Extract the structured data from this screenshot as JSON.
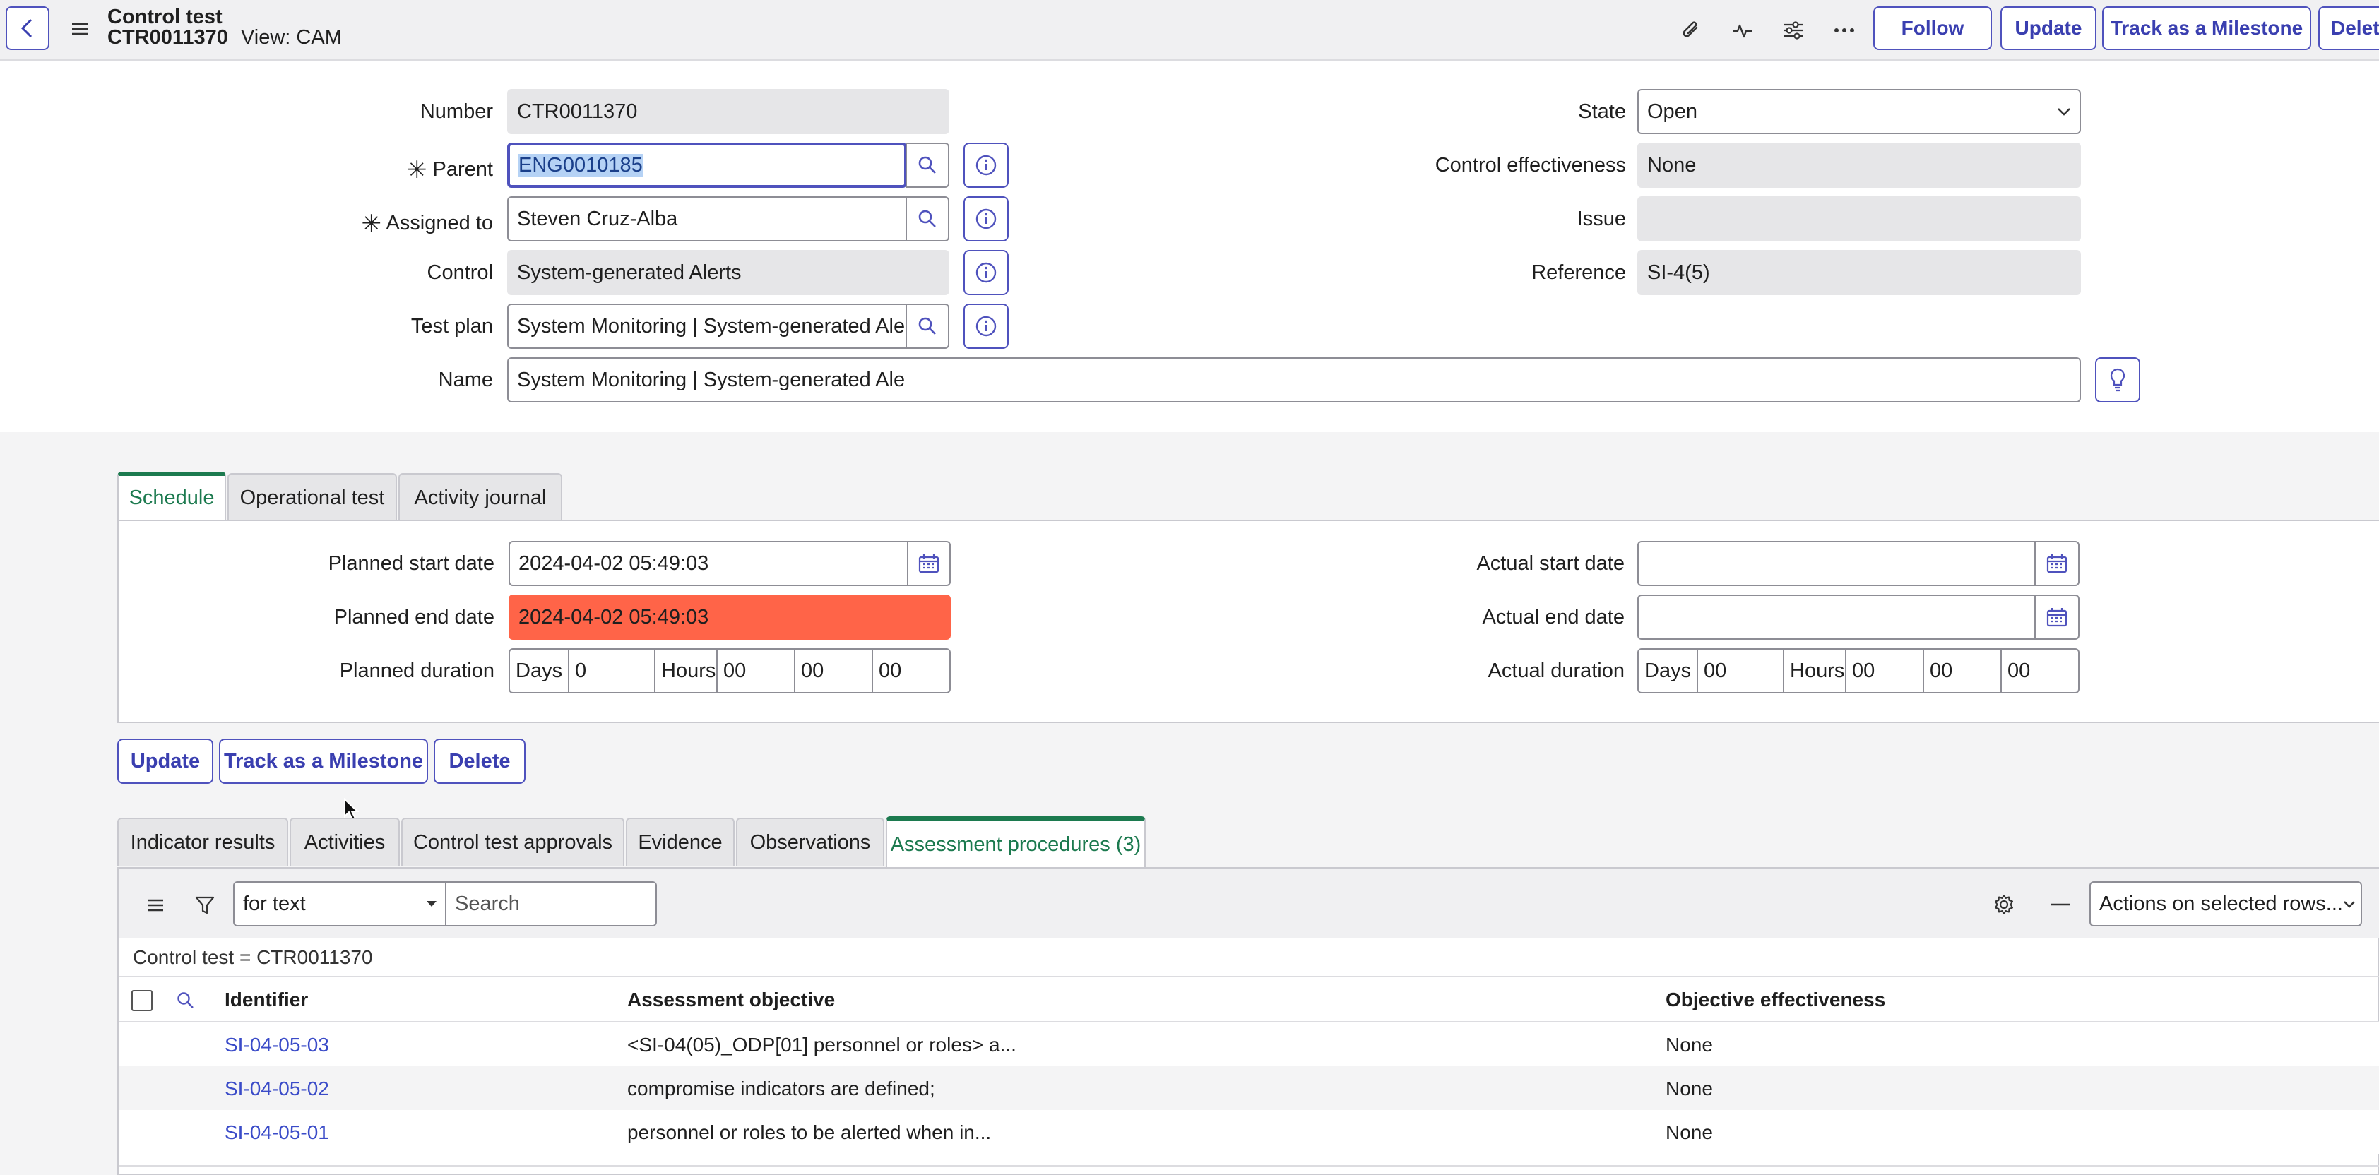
{
  "header": {
    "title": "Control test",
    "number": "CTR0011370",
    "view": "View: CAM",
    "buttons": {
      "follow": "Follow",
      "update": "Update",
      "milestone": "Track as a Milestone",
      "delete": "Delet"
    }
  },
  "form": {
    "number_label": "Number",
    "number_value": "CTR0011370",
    "parent_label": "Parent",
    "parent_value": "ENG0010185",
    "assigned_label": "Assigned to",
    "assigned_value": "Steven Cruz-Alba",
    "control_label": "Control",
    "control_value": "System-generated Alerts",
    "testplan_label": "Test plan",
    "testplan_value": "System Monitoring | System-generated Ale",
    "name_label": "Name",
    "name_value": "System Monitoring | System-generated Ale",
    "state_label": "State",
    "state_value": "Open",
    "effectiveness_label": "Control effectiveness",
    "effectiveness_value": "None",
    "issue_label": "Issue",
    "issue_value": "",
    "reference_label": "Reference",
    "reference_value": "SI-4(5)"
  },
  "section_tabs": [
    "Schedule",
    "Operational test",
    "Activity journal"
  ],
  "schedule": {
    "planned_start_label": "Planned start date",
    "planned_start_value": "2024-04-02 05:49:03",
    "planned_end_label": "Planned end date",
    "planned_end_value": "2024-04-02 05:49:03",
    "planned_duration_label": "Planned duration",
    "planned_duration": {
      "days_label": "Days",
      "days": "0",
      "hours_label": "Hours",
      "hours": "00",
      "minutes": "00",
      "seconds": "00"
    },
    "actual_start_label": "Actual start date",
    "actual_start_value": "",
    "actual_end_label": "Actual end date",
    "actual_end_value": "",
    "actual_duration_label": "Actual duration",
    "actual_duration": {
      "days_label": "Days",
      "days": "00",
      "hours_label": "Hours",
      "hours": "00",
      "minutes": "00",
      "seconds": "00"
    }
  },
  "form_buttons": {
    "update": "Update",
    "milestone": "Track as a Milestone",
    "delete": "Delete"
  },
  "related_tabs": [
    "Indicator results",
    "Activities",
    "Control test approvals",
    "Evidence",
    "Observations",
    "Assessment procedures (3)"
  ],
  "list": {
    "search_field": "for text",
    "search_placeholder": "Search",
    "actions": "Actions on selected rows...",
    "breadcrumb": "Control test = CTR0011370",
    "columns": [
      "Identifier",
      "Assessment objective",
      "Objective effectiveness"
    ],
    "rows": [
      {
        "identifier": "SI-04-05-03",
        "objective": "<SI-04(05)_ODP[01] personnel or roles> a...",
        "effectiveness": "None"
      },
      {
        "identifier": "SI-04-05-02",
        "objective": "compromise indicators are defined;",
        "effectiveness": "None"
      },
      {
        "identifier": "SI-04-05-01",
        "objective": "personnel or roles to be alerted when in...",
        "effectiveness": "None"
      }
    ]
  },
  "colors": {
    "accent": "#4f52bd",
    "active_tab": "#1c7a4f",
    "overdue": "#ff6448",
    "link": "#3a4bc8"
  },
  "icons": [
    "back-icon",
    "menu-icon",
    "paperclip-icon",
    "activity-icon",
    "sliders-icon",
    "more-icon",
    "search-icon",
    "info-icon",
    "lightbulb-icon",
    "calendar-icon",
    "filter-icon",
    "gear-icon",
    "collapse-icon",
    "chevron-down-icon"
  ]
}
